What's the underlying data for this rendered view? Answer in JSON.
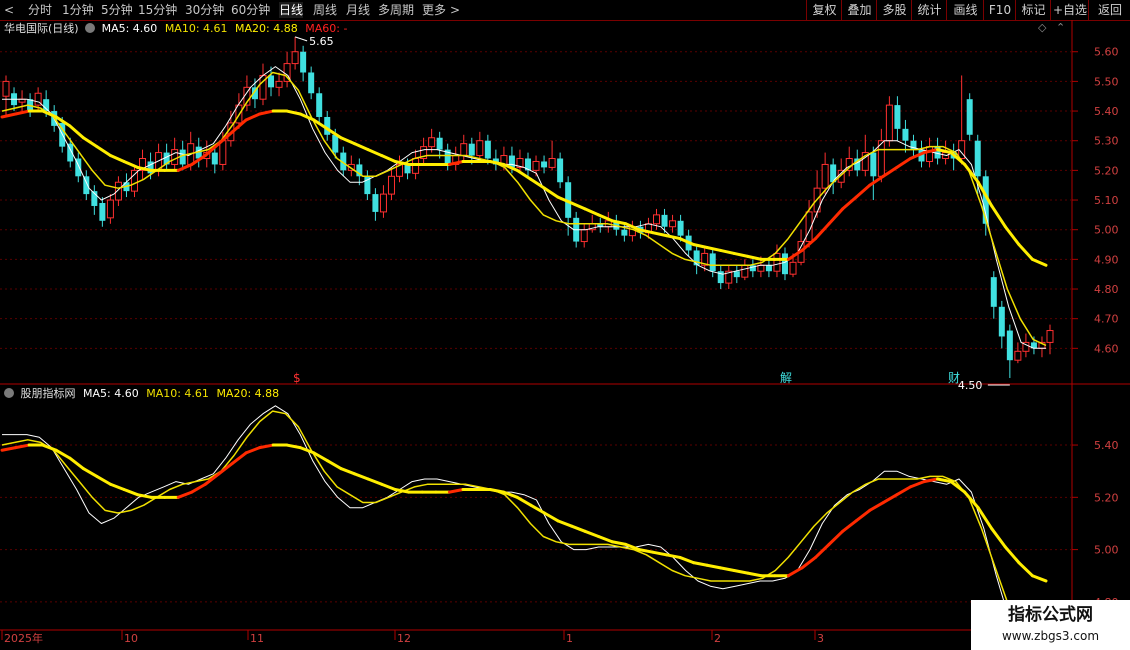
{
  "toolbar": {
    "left_arrow": "<",
    "periods": [
      "分时",
      "1分钟",
      "5分钟",
      "15分钟",
      "30分钟",
      "60分钟",
      "日线",
      "周线",
      "月线",
      "多周期",
      "更多"
    ],
    "active_index": 6,
    "more_chevron": ">",
    "right_buttons": [
      "复权",
      "叠加",
      "多股",
      "统计",
      "画线",
      "F10",
      "标记",
      "+自选",
      "返回"
    ]
  },
  "main_panel": {
    "stock_name": "华电国际(日线)",
    "ma5": "MA5: 4.60",
    "ma10": "MA10: 4.61",
    "ma20": "MA20: 4.88",
    "ma60": "MA60: -",
    "y_ticks": [
      "5.60",
      "5.50",
      "5.40",
      "5.30",
      "5.20",
      "5.10",
      "5.00",
      "4.90",
      "4.80",
      "4.70",
      "4.60"
    ],
    "high_label": "5.65",
    "low_label": "4.50",
    "markers": [
      "$",
      "解",
      "财"
    ]
  },
  "sub_panel": {
    "name": "股朋指标网",
    "ma5": "MA5: 4.60",
    "ma10": "MA10: 4.61",
    "ma20": "MA20: 4.88",
    "y_ticks": [
      "5.40",
      "5.20",
      "5.00",
      "4.80"
    ]
  },
  "date_axis": [
    "2025年",
    "10",
    "11",
    "12",
    "1",
    "2",
    "3"
  ],
  "watermark": {
    "title": "指标公式网",
    "url": "www.zbgs3.com"
  },
  "colors": {
    "up": "#ff3030",
    "down": "#40e0e0",
    "ma5": "#ffffff",
    "ma10": "#f0e000",
    "ma20": "#ffee00",
    "ma60": "#ff2020",
    "axis": "#d04040"
  },
  "chart_data": {
    "type": "candlestick",
    "ylim": [
      4.5,
      5.68
    ],
    "sub_ylim": [
      4.7,
      5.58
    ],
    "candles": [
      [
        5.45,
        5.5,
        5.52,
        5.38
      ],
      [
        5.46,
        5.42,
        5.48,
        5.4
      ],
      [
        5.43,
        5.44,
        5.47,
        5.4
      ],
      [
        5.44,
        5.4,
        5.46,
        5.38
      ],
      [
        5.42,
        5.46,
        5.48,
        5.4
      ],
      [
        5.44,
        5.4,
        5.47,
        5.38
      ],
      [
        5.4,
        5.35,
        5.42,
        5.33
      ],
      [
        5.36,
        5.28,
        5.38,
        5.26
      ],
      [
        5.29,
        5.23,
        5.31,
        5.21
      ],
      [
        5.24,
        5.18,
        5.26,
        5.16
      ],
      [
        5.18,
        5.12,
        5.2,
        5.1
      ],
      [
        5.13,
        5.08,
        5.15,
        5.05
      ],
      [
        5.09,
        5.03,
        5.11,
        5.01
      ],
      [
        5.04,
        5.1,
        5.12,
        5.02
      ],
      [
        5.1,
        5.16,
        5.18,
        5.08
      ],
      [
        5.16,
        5.13,
        5.19,
        5.11
      ],
      [
        5.13,
        5.2,
        5.22,
        5.11
      ],
      [
        5.2,
        5.24,
        5.27,
        5.17
      ],
      [
        5.23,
        5.19,
        5.26,
        5.17
      ],
      [
        5.2,
        5.26,
        5.29,
        5.18
      ],
      [
        5.26,
        5.22,
        5.29,
        5.2
      ],
      [
        5.22,
        5.27,
        5.31,
        5.2
      ],
      [
        5.27,
        5.22,
        5.3,
        5.2
      ],
      [
        5.22,
        5.29,
        5.33,
        5.2
      ],
      [
        5.28,
        5.24,
        5.31,
        5.21
      ],
      [
        5.24,
        5.26,
        5.3,
        5.21
      ],
      [
        5.26,
        5.22,
        5.28,
        5.19
      ],
      [
        5.22,
        5.3,
        5.33,
        5.2
      ],
      [
        5.3,
        5.36,
        5.4,
        5.28
      ],
      [
        5.36,
        5.42,
        5.46,
        5.34
      ],
      [
        5.42,
        5.48,
        5.52,
        5.4
      ],
      [
        5.48,
        5.44,
        5.51,
        5.41
      ],
      [
        5.44,
        5.52,
        5.56,
        5.42
      ],
      [
        5.52,
        5.48,
        5.55,
        5.45
      ],
      [
        5.48,
        5.5,
        5.53,
        5.45
      ],
      [
        5.5,
        5.56,
        5.6,
        5.48
      ],
      [
        5.56,
        5.6,
        5.65,
        5.54
      ],
      [
        5.6,
        5.53,
        5.62,
        5.5
      ],
      [
        5.53,
        5.46,
        5.55,
        5.44
      ],
      [
        5.46,
        5.38,
        5.48,
        5.36
      ],
      [
        5.38,
        5.32,
        5.4,
        5.3
      ],
      [
        5.32,
        5.26,
        5.34,
        5.24
      ],
      [
        5.26,
        5.2,
        5.28,
        5.18
      ],
      [
        5.2,
        5.22,
        5.25,
        5.18
      ],
      [
        5.22,
        5.18,
        5.24,
        5.15
      ],
      [
        5.18,
        5.12,
        5.2,
        5.1
      ],
      [
        5.12,
        5.06,
        5.14,
        5.03
      ],
      [
        5.06,
        5.12,
        5.15,
        5.04
      ],
      [
        5.12,
        5.18,
        5.21,
        5.1
      ],
      [
        5.18,
        5.22,
        5.25,
        5.16
      ],
      [
        5.22,
        5.19,
        5.24,
        5.17
      ],
      [
        5.19,
        5.24,
        5.27,
        5.17
      ],
      [
        5.24,
        5.28,
        5.31,
        5.22
      ],
      [
        5.28,
        5.31,
        5.34,
        5.26
      ],
      [
        5.31,
        5.27,
        5.33,
        5.24
      ],
      [
        5.27,
        5.22,
        5.29,
        5.2
      ],
      [
        5.22,
        5.25,
        5.28,
        5.2
      ],
      [
        5.25,
        5.29,
        5.32,
        5.23
      ],
      [
        5.29,
        5.25,
        5.31,
        5.22
      ],
      [
        5.25,
        5.3,
        5.33,
        5.23
      ],
      [
        5.3,
        5.24,
        5.32,
        5.22
      ],
      [
        5.24,
        5.22,
        5.27,
        5.2
      ],
      [
        5.22,
        5.25,
        5.28,
        5.2
      ],
      [
        5.25,
        5.21,
        5.28,
        5.19
      ],
      [
        5.21,
        5.24,
        5.27,
        5.19
      ],
      [
        5.24,
        5.2,
        5.26,
        5.18
      ],
      [
        5.2,
        5.23,
        5.25,
        5.18
      ],
      [
        5.23,
        5.21,
        5.25,
        5.19
      ],
      [
        5.21,
        5.24,
        5.3,
        5.2
      ],
      [
        5.24,
        5.16,
        5.26,
        5.14
      ],
      [
        5.16,
        5.04,
        5.18,
        4.98
      ],
      [
        5.04,
        4.96,
        5.06,
        4.94
      ],
      [
        4.96,
        5.0,
        5.02,
        4.94
      ],
      [
        5.0,
        5.02,
        5.05,
        4.99
      ],
      [
        5.02,
        5.01,
        5.04,
        4.99
      ],
      [
        5.01,
        5.03,
        5.06,
        4.99
      ],
      [
        5.03,
        5.0,
        5.05,
        4.98
      ],
      [
        5.0,
        4.98,
        5.02,
        4.96
      ],
      [
        4.98,
        5.01,
        5.03,
        4.96
      ],
      [
        5.01,
        4.99,
        5.03,
        4.97
      ],
      [
        4.99,
        5.02,
        5.04,
        4.97
      ],
      [
        5.02,
        5.05,
        5.07,
        5.0
      ],
      [
        5.05,
        5.01,
        5.07,
        4.99
      ],
      [
        5.01,
        5.03,
        5.05,
        4.99
      ],
      [
        5.03,
        4.98,
        5.05,
        4.96
      ],
      [
        4.98,
        4.93,
        5.0,
        4.91
      ],
      [
        4.93,
        4.88,
        4.95,
        4.85
      ],
      [
        4.88,
        4.92,
        4.94,
        4.86
      ],
      [
        4.92,
        4.86,
        4.94,
        4.84
      ],
      [
        4.86,
        4.82,
        4.88,
        4.8
      ],
      [
        4.82,
        4.86,
        4.88,
        4.8
      ],
      [
        4.86,
        4.84,
        4.88,
        4.82
      ],
      [
        4.84,
        4.88,
        4.9,
        4.83
      ],
      [
        4.88,
        4.86,
        4.9,
        4.84
      ],
      [
        4.86,
        4.88,
        4.91,
        4.84
      ],
      [
        4.88,
        4.86,
        4.9,
        4.84
      ],
      [
        4.86,
        4.92,
        4.95,
        4.84
      ],
      [
        4.92,
        4.85,
        4.94,
        4.83
      ],
      [
        4.85,
        4.89,
        4.92,
        4.84
      ],
      [
        4.89,
        4.96,
        5.0,
        4.88
      ],
      [
        4.96,
        5.06,
        5.1,
        4.94
      ],
      [
        5.06,
        5.14,
        5.2,
        5.04
      ],
      [
        5.14,
        5.22,
        5.26,
        5.12
      ],
      [
        5.22,
        5.16,
        5.24,
        5.12
      ],
      [
        5.16,
        5.2,
        5.24,
        5.14
      ],
      [
        5.2,
        5.24,
        5.28,
        5.18
      ],
      [
        5.24,
        5.2,
        5.27,
        5.18
      ],
      [
        5.2,
        5.26,
        5.32,
        5.18
      ],
      [
        5.26,
        5.18,
        5.28,
        5.1
      ],
      [
        5.18,
        5.3,
        5.34,
        5.16
      ],
      [
        5.3,
        5.42,
        5.45,
        5.28
      ],
      [
        5.42,
        5.34,
        5.45,
        5.3
      ],
      [
        5.34,
        5.3,
        5.37,
        5.26
      ],
      [
        5.3,
        5.27,
        5.32,
        5.24
      ],
      [
        5.27,
        5.23,
        5.3,
        5.21
      ],
      [
        5.23,
        5.28,
        5.31,
        5.21
      ],
      [
        5.28,
        5.24,
        5.31,
        5.22
      ],
      [
        5.24,
        5.26,
        5.3,
        5.22
      ],
      [
        5.26,
        5.24,
        5.29,
        5.2
      ],
      [
        5.24,
        5.3,
        5.52,
        5.22
      ],
      [
        5.44,
        5.32,
        5.46,
        5.3
      ],
      [
        5.3,
        5.18,
        5.32,
        5.12
      ],
      [
        5.18,
        5.02,
        5.2,
        4.98
      ],
      [
        4.84,
        4.74,
        4.86,
        4.7
      ],
      [
        4.74,
        4.64,
        4.76,
        4.6
      ],
      [
        4.66,
        4.56,
        4.68,
        4.5
      ],
      [
        4.56,
        4.59,
        4.62,
        4.55
      ],
      [
        4.59,
        4.62,
        4.65,
        4.57
      ],
      [
        4.62,
        4.6,
        4.64,
        4.58
      ],
      [
        4.6,
        4.62,
        4.64,
        4.57
      ],
      [
        4.62,
        4.66,
        4.68,
        4.58
      ]
    ],
    "ma5_levels": [
      5.44,
      5.44,
      5.44,
      5.43,
      5.39,
      5.31,
      5.23,
      5.14,
      5.1,
      5.12,
      5.16,
      5.2,
      5.22,
      5.24,
      5.26,
      5.25,
      5.27,
      5.29,
      5.35,
      5.42,
      5.48,
      5.52,
      5.55,
      5.52,
      5.44,
      5.34,
      5.26,
      5.2,
      5.16,
      5.16,
      5.18,
      5.2,
      5.23,
      5.26,
      5.27,
      5.27,
      5.26,
      5.25,
      5.24,
      5.23,
      5.22,
      5.22,
      5.21,
      5.19,
      5.1,
      5.03,
      5.0,
      5.0,
      5.01,
      5.01,
      5.01,
      5.01,
      5.02,
      5.01,
      4.97,
      4.92,
      4.88,
      4.86,
      4.85,
      4.86,
      4.87,
      4.88,
      4.88,
      4.89,
      4.92,
      5.0,
      5.1,
      5.17,
      5.21,
      5.23,
      5.26,
      5.3,
      5.3,
      5.28,
      5.27,
      5.26,
      5.25,
      5.27,
      5.22,
      5.08,
      4.9,
      4.74,
      4.62,
      4.6,
      4.6
    ],
    "ma10_levels": [
      5.4,
      5.41,
      5.42,
      5.41,
      5.38,
      5.32,
      5.26,
      5.2,
      5.15,
      5.14,
      5.15,
      5.17,
      5.2,
      5.23,
      5.25,
      5.26,
      5.27,
      5.3,
      5.36,
      5.43,
      5.49,
      5.53,
      5.52,
      5.47,
      5.38,
      5.3,
      5.24,
      5.21,
      5.18,
      5.18,
      5.2,
      5.22,
      5.24,
      5.25,
      5.25,
      5.25,
      5.25,
      5.24,
      5.23,
      5.21,
      5.16,
      5.1,
      5.05,
      5.03,
      5.02,
      5.02,
      5.02,
      5.02,
      5.01,
      5.0,
      4.98,
      4.95,
      4.92,
      4.9,
      4.89,
      4.88,
      4.88,
      4.88,
      4.88,
      4.89,
      4.92,
      4.97,
      5.03,
      5.09,
      5.14,
      5.18,
      5.22,
      5.25,
      5.27,
      5.27,
      5.27,
      5.27,
      5.28,
      5.28,
      5.26,
      5.2,
      5.08,
      4.94,
      4.8,
      4.7,
      4.63,
      4.61
    ],
    "ma20_levels": [
      5.38,
      5.39,
      5.4,
      5.4,
      5.38,
      5.35,
      5.31,
      5.28,
      5.25,
      5.23,
      5.21,
      5.2,
      5.2,
      5.2,
      5.22,
      5.25,
      5.29,
      5.33,
      5.37,
      5.39,
      5.4,
      5.4,
      5.39,
      5.37,
      5.34,
      5.31,
      5.29,
      5.27,
      5.25,
      5.23,
      5.22,
      5.22,
      5.22,
      5.22,
      5.23,
      5.23,
      5.23,
      5.22,
      5.2,
      5.17,
      5.14,
      5.11,
      5.09,
      5.07,
      5.05,
      5.03,
      5.02,
      5.0,
      4.99,
      4.98,
      4.97,
      4.95,
      4.94,
      4.93,
      4.92,
      4.91,
      4.9,
      4.9,
      4.9,
      4.93,
      4.97,
      5.02,
      5.07,
      5.11,
      5.15,
      5.18,
      5.21,
      5.24,
      5.26,
      5.27,
      5.26,
      5.22,
      5.16,
      5.08,
      5.01,
      4.95,
      4.9,
      4.88
    ]
  }
}
